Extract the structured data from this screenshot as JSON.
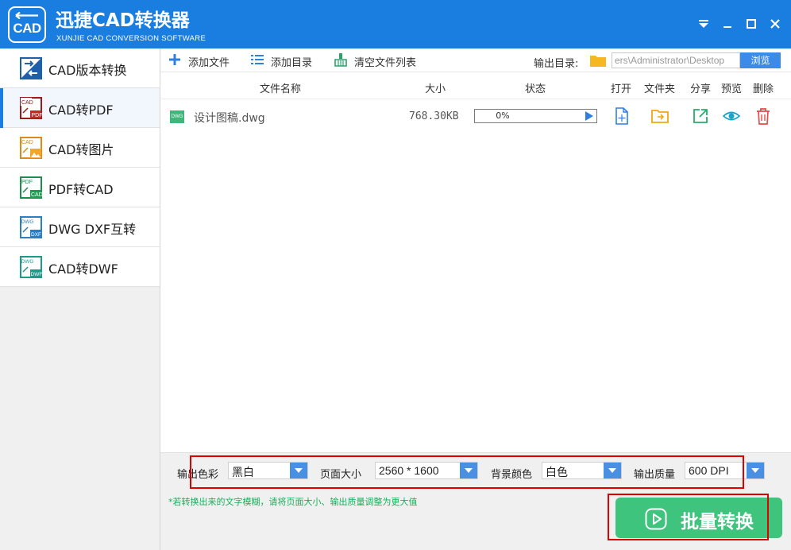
{
  "window": {
    "logo_text": "CAD",
    "title": "迅捷CAD转换器",
    "subtitle": "XUNJIE CAD CONVERSION SOFTWARE"
  },
  "sidebar": {
    "items": [
      {
        "label": "CAD版本转换",
        "icon": "version-convert-icon",
        "active": false
      },
      {
        "label": "CAD转PDF",
        "icon": "cad-to-pdf-icon",
        "active": true
      },
      {
        "label": "CAD转图片",
        "icon": "cad-to-image-icon",
        "active": false
      },
      {
        "label": "PDF转CAD",
        "icon": "pdf-to-cad-icon",
        "active": false
      },
      {
        "label": "DWG DXF互转",
        "icon": "dwg-dxf-icon",
        "active": false
      },
      {
        "label": "CAD转DWF",
        "icon": "cad-to-dwf-icon",
        "active": false
      }
    ]
  },
  "toolbar": {
    "add_file": "添加文件",
    "add_folder": "添加目录",
    "clear_list": "清空文件列表",
    "output_dir_label": "输出目录:",
    "output_dir_value": "ers\\Administrator\\Desktop",
    "browse": "浏览"
  },
  "table": {
    "headers": {
      "name": "文件名称",
      "size": "大小",
      "status": "状态",
      "open": "打开",
      "folder": "文件夹",
      "share": "分享",
      "preview": "预览",
      "delete": "删除"
    },
    "rows": [
      {
        "icon_text": "DWG",
        "name": "设计图稿.dwg",
        "size": "768.30KB",
        "progress_text": "0%",
        "progress": 0
      }
    ]
  },
  "options": {
    "color_label": "输出色彩",
    "color_value": "黑白",
    "page_size_label": "页面大小",
    "page_size_value": "2560 * 1600",
    "bg_color_label": "背景颜色",
    "bg_color_value": "白色",
    "quality_label": "输出质量",
    "quality_value": "600 DPI",
    "hint": "*若转换出来的文字模糊，请将页面大小、输出质量调整为更大值",
    "convert_button": "批量转换"
  },
  "colors": {
    "brand_blue": "#1a7de0",
    "convert_green": "#3ec47c",
    "highlight_red": "#e00000"
  }
}
